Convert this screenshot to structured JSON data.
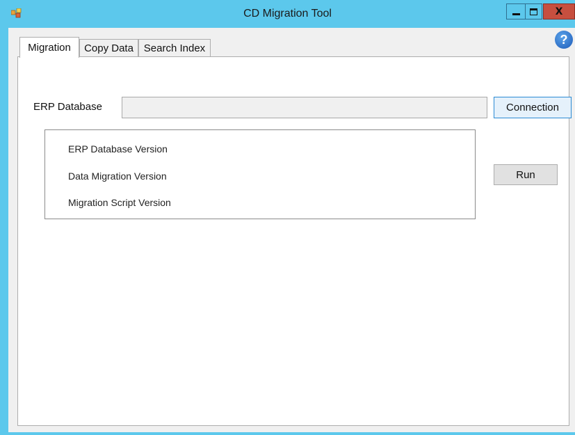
{
  "window": {
    "title": "CD Migration Tool",
    "accent_color": "#5cc8ec",
    "close_color": "#c74f3f",
    "icons": {
      "app": "app-icon",
      "minimize": "minimize-icon",
      "maximize": "maximize-icon",
      "close": "close-icon",
      "help": "help-icon"
    },
    "close_glyph": "X",
    "help_glyph": "?"
  },
  "tabs": [
    {
      "label": "Migration",
      "active": true
    },
    {
      "label": "Copy Data",
      "active": false
    },
    {
      "label": "Search Index",
      "active": false
    }
  ],
  "migration": {
    "erp_label": "ERP Database",
    "erp_value": "",
    "connection_label": "Connection",
    "run_label": "Run",
    "versions": [
      "ERP Database Version",
      "Data Migration Version",
      "Migration Script Version"
    ]
  }
}
